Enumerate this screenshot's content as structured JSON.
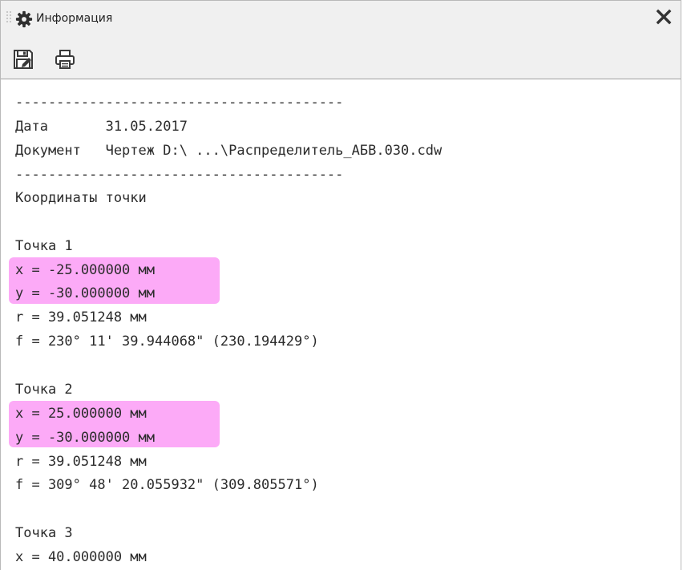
{
  "window": {
    "title": "Информация",
    "close_glyph": "X",
    "icons": [
      "grip-icon",
      "gear-icon",
      "close-icon"
    ]
  },
  "toolbar": {
    "buttons": [
      {
        "icon": "save-icon"
      },
      {
        "icon": "print-icon"
      }
    ]
  },
  "report": {
    "separator_top": "----------------------------------------",
    "date_label": "Дата       31.05.2017",
    "document_label": "Документ   Чертеж D:\\ ...\\Распределитель_АБВ.030.cdw",
    "separator_bottom": "----------------------------------------",
    "section_title": "Координаты точки",
    "points": [
      {
        "name": "Точка 1",
        "x": "x = -25.000000 мм",
        "y": "y = -30.000000 мм",
        "r": "r = 39.051248 мм",
        "f": "f = 230° 11' 39.944068\" (230.194429°)",
        "highlighted": true
      },
      {
        "name": "Точка 2",
        "x": "x = 25.000000 мм",
        "y": "y = -30.000000 мм",
        "r": "r = 39.051248 мм",
        "f": "f = 309° 48' 20.055932\" (309.805571°)",
        "highlighted": true
      },
      {
        "name": "Точка 3",
        "x": "x = 40.000000 мм"
      }
    ]
  },
  "colors": {
    "highlight": "#fcaaf7",
    "chrome": "#f0f0f0",
    "text": "#2c2c2c"
  }
}
